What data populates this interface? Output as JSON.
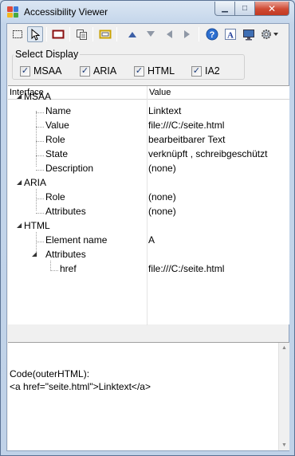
{
  "window": {
    "title": "Accessibility Viewer",
    "controls": {
      "minimize": "▁",
      "maximize": "□",
      "close": "✕"
    }
  },
  "toolbar": {
    "icons": [
      "select-rectangle-icon",
      "pointer-icon",
      "highlight-frame-icon",
      "copy-icon",
      "focus-frame-icon",
      "move-up-icon",
      "move-down-icon",
      "move-left-icon",
      "move-right-icon",
      "help-icon",
      "font-icon",
      "display-icon",
      "settings-icon"
    ]
  },
  "select_display": {
    "label": "Select Display",
    "options": [
      {
        "label": "MSAA",
        "checked": true
      },
      {
        "label": "ARIA",
        "checked": true
      },
      {
        "label": "HTML",
        "checked": true
      },
      {
        "label": "IA2",
        "checked": true
      }
    ]
  },
  "tree": {
    "columns": {
      "interface": "Interface",
      "value": "Value"
    },
    "msaa": {
      "label": "MSAA",
      "name": {
        "label": "Name",
        "value": "Linktext"
      },
      "value": {
        "label": "Value",
        "value": "file:///C:/seite.html"
      },
      "role": {
        "label": "Role",
        "value": "bearbeitbarer Text"
      },
      "state": {
        "label": "State",
        "value": "verknüpft , schreibgeschützt"
      },
      "description": {
        "label": "Description",
        "value": "(none)"
      }
    },
    "aria": {
      "label": "ARIA",
      "role": {
        "label": "Role",
        "value": "(none)"
      },
      "attributes": {
        "label": "Attributes",
        "value": "(none)"
      }
    },
    "html": {
      "label": "HTML",
      "element_name": {
        "label": "Element name",
        "value": "A"
      },
      "attributes": {
        "label": "Attributes"
      },
      "href": {
        "label": "href",
        "value": "file:///C:/seite.html"
      }
    }
  },
  "code_panel": {
    "heading": "Code(outerHTML):",
    "code": "<a href=\"seite.html\">Linktext</a>"
  },
  "colors": {
    "title_bar": "#c3d5ea",
    "close_button": "#cf4a33",
    "toolbar_blue": "#3c5fa6"
  }
}
